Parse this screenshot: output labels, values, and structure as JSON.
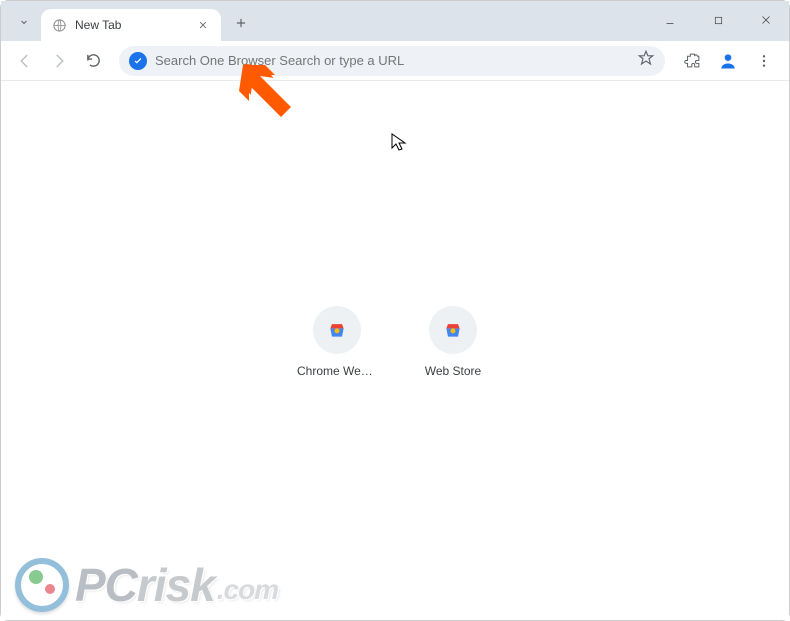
{
  "tab": {
    "title": "New Tab"
  },
  "omnibox": {
    "placeholder": "Search One Browser Search or type a URL"
  },
  "shortcuts": [
    {
      "label": "Chrome Web..."
    },
    {
      "label": "Web Store"
    }
  ],
  "watermark": {
    "brand": "PC",
    "rest": "risk",
    "domain": ".com"
  }
}
